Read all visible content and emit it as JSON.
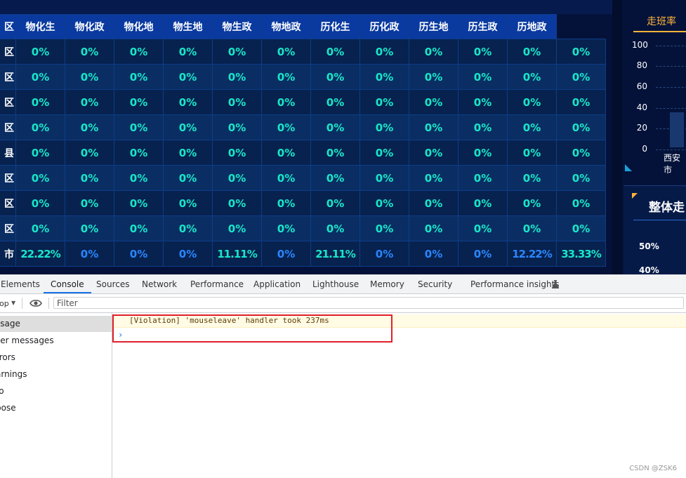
{
  "table": {
    "headers": [
      "区",
      "物化生",
      "物化政",
      "物化地",
      "物生地",
      "物生政",
      "物地政",
      "历化生",
      "历化政",
      "历生地",
      "历生政",
      "历地政"
    ],
    "rows": [
      {
        "name": "区",
        "values": [
          "0%",
          "0%",
          "0%",
          "0%",
          "0%",
          "0%",
          "0%",
          "0%",
          "0%",
          "0%",
          "0%",
          "0%"
        ]
      },
      {
        "name": "区",
        "values": [
          "0%",
          "0%",
          "0%",
          "0%",
          "0%",
          "0%",
          "0%",
          "0%",
          "0%",
          "0%",
          "0%",
          "0%"
        ]
      },
      {
        "name": "区",
        "values": [
          "0%",
          "0%",
          "0%",
          "0%",
          "0%",
          "0%",
          "0%",
          "0%",
          "0%",
          "0%",
          "0%",
          "0%"
        ]
      },
      {
        "name": "区",
        "values": [
          "0%",
          "0%",
          "0%",
          "0%",
          "0%",
          "0%",
          "0%",
          "0%",
          "0%",
          "0%",
          "0%",
          "0%"
        ]
      },
      {
        "name": "县",
        "values": [
          "0%",
          "0%",
          "0%",
          "0%",
          "0%",
          "0%",
          "0%",
          "0%",
          "0%",
          "0%",
          "0%",
          "0%"
        ]
      },
      {
        "name": "区",
        "values": [
          "0%",
          "0%",
          "0%",
          "0%",
          "0%",
          "0%",
          "0%",
          "0%",
          "0%",
          "0%",
          "0%",
          "0%"
        ]
      },
      {
        "name": "区",
        "values": [
          "0%",
          "0%",
          "0%",
          "0%",
          "0%",
          "0%",
          "0%",
          "0%",
          "0%",
          "0%",
          "0%",
          "0%"
        ]
      },
      {
        "name": "区",
        "values": [
          "0%",
          "0%",
          "0%",
          "0%",
          "0%",
          "0%",
          "0%",
          "0%",
          "0%",
          "0%",
          "0%",
          "0%"
        ]
      },
      {
        "name": "市",
        "values": [
          "22.22%",
          "0%",
          "0%",
          "0%",
          "11.11%",
          "0%",
          "21.11%",
          "0%",
          "0%",
          "0%",
          "12.22%",
          "33.33%"
        ],
        "blue_cols": [
          1,
          2,
          3,
          5,
          7,
          8,
          9,
          10
        ]
      }
    ]
  },
  "right_panel": {
    "tab_label": "走班率",
    "y_ticks": [
      "100",
      "80",
      "60",
      "40",
      "20",
      "0"
    ],
    "x_label": "西安市",
    "panel2_title": "整体走",
    "panel2_ticks": [
      "50%",
      "40%"
    ],
    "colors": {
      "accent": "#ffb43a",
      "cyan": "#19e6c8",
      "blue": "#2a86ff"
    }
  },
  "devtools": {
    "tabs": [
      "Elements",
      "Console",
      "Sources",
      "Network",
      "Performance",
      "Application",
      "Lighthouse",
      "Memory",
      "Security",
      "Performance insights"
    ],
    "active_tab": "Console",
    "context_label": "op",
    "filter_placeholder": "Filter",
    "sidebar": [
      "ssage",
      "ser messages",
      "rrors",
      "arnings",
      "fo",
      "bose"
    ],
    "violation_message": "[Violation] 'mouseleave' handler took 237ms",
    "prompt": "›"
  },
  "watermark": "CSDN @ZSK6"
}
